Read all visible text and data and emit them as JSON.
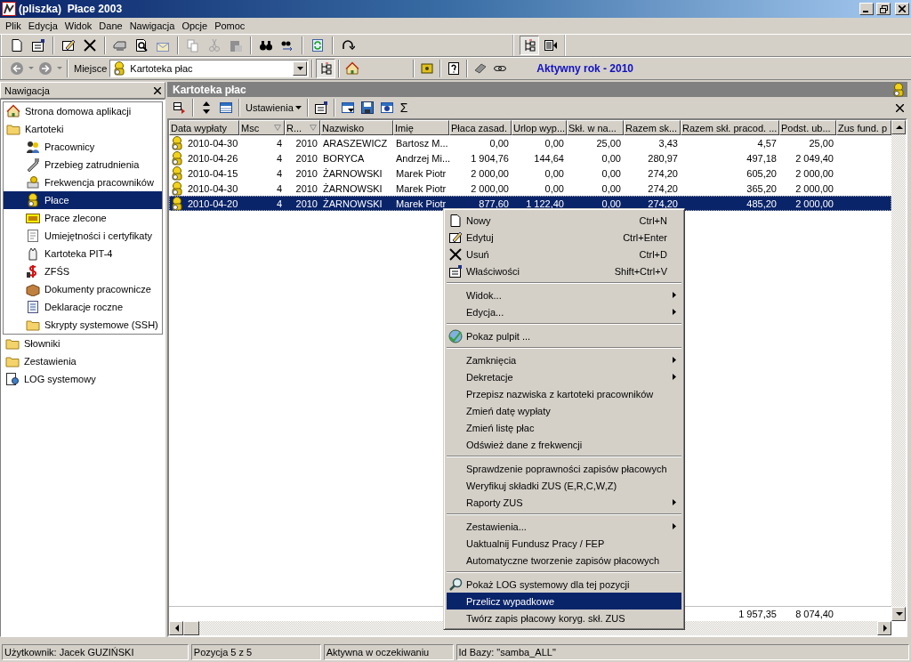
{
  "window": {
    "title": "(pliszka)  Płace 2003"
  },
  "menu": [
    "Plik",
    "Edycja",
    "Widok",
    "Dane",
    "Nawigacja",
    "Opcje",
    "Pomoc"
  ],
  "location": {
    "label": "Miejsce",
    "value": "Kartoteka płac"
  },
  "active_year": "Aktywny rok - 2010",
  "navigation": {
    "title": "Nawigacja",
    "items": [
      {
        "label": "Strona domowa aplikacji",
        "selected": false
      },
      {
        "label": "Kartoteki",
        "selected": false,
        "children": [
          {
            "label": "Pracownicy",
            "selected": false
          },
          {
            "label": "Przebieg zatrudnienia",
            "selected": false
          },
          {
            "label": "Frekwencja pracowników",
            "selected": false
          },
          {
            "label": "Płace",
            "selected": true
          },
          {
            "label": "Prace zlecone",
            "selected": false
          },
          {
            "label": "Umiejętności i certyfikaty",
            "selected": false
          },
          {
            "label": "Kartoteka PIT-4",
            "selected": false
          },
          {
            "label": "ZFŚS",
            "selected": false
          },
          {
            "label": "Dokumenty pracownicze",
            "selected": false
          },
          {
            "label": "Deklaracje roczne",
            "selected": false
          },
          {
            "label": "Skrypty systemowe (SSH)",
            "selected": false
          }
        ]
      },
      {
        "label": "Słowniki",
        "selected": false
      },
      {
        "label": "Zestawienia",
        "selected": false
      },
      {
        "label": "LOG systemowy",
        "selected": false
      }
    ]
  },
  "pane": {
    "title": "Kartoteka płac",
    "settings_button": "Ustawienia",
    "sum_button": "Σ"
  },
  "table": {
    "columns": [
      {
        "label": "Data wypłaty",
        "kind": "text",
        "filtered": false
      },
      {
        "label": "Msc",
        "kind": "number",
        "filtered": true
      },
      {
        "label": "R...",
        "kind": "number",
        "filtered": true
      },
      {
        "label": "Nazwisko",
        "kind": "text",
        "filtered": false
      },
      {
        "label": "Imię",
        "kind": "text",
        "filtered": false
      },
      {
        "label": "Płaca zasad.",
        "kind": "number",
        "filtered": false
      },
      {
        "label": "Urlop wyp...",
        "kind": "number",
        "filtered": false
      },
      {
        "label": "Skł. w na...",
        "kind": "number",
        "filtered": false
      },
      {
        "label": "Razem sk...",
        "kind": "number",
        "filtered": false
      },
      {
        "label": "Razem skł. pracod. ...",
        "kind": "number",
        "filtered": false,
        "total": "1 957,35"
      },
      {
        "label": "Podst. ub...",
        "kind": "number",
        "filtered": false,
        "total": "8 074,40"
      },
      {
        "label": "Zus fund. p",
        "kind": "number",
        "filtered": false
      }
    ],
    "rows": [
      {
        "selected": false,
        "cells": [
          "2010-04-30",
          "4",
          "2010",
          "ARASZEWICZ",
          "Bartosz M...",
          "0,00",
          "0,00",
          "25,00",
          "3,43",
          "4,57",
          "25,00"
        ]
      },
      {
        "selected": false,
        "cells": [
          "2010-04-26",
          "4",
          "2010",
          "BORYCA",
          "Andrzej Mi...",
          "1 904,76",
          "144,64",
          "0,00",
          "280,97",
          "497,18",
          "2 049,40"
        ]
      },
      {
        "selected": false,
        "cells": [
          "2010-04-15",
          "4",
          "2010",
          "ŻARNOWSKI",
          "Marek Piotr",
          "2 000,00",
          "0,00",
          "0,00",
          "274,20",
          "605,20",
          "2 000,00"
        ]
      },
      {
        "selected": false,
        "cells": [
          "2010-04-30",
          "4",
          "2010",
          "ŻARNOWSKI",
          "Marek Piotr",
          "2 000,00",
          "0,00",
          "0,00",
          "274,20",
          "365,20",
          "2 000,00"
        ]
      },
      {
        "selected": true,
        "cells": [
          "2010-04-20",
          "4",
          "2010",
          "ŻARNOWSKI",
          "Marek Piotr",
          "877,60",
          "1 122,40",
          "0,00",
          "274,20",
          "485,20",
          "2 000,00"
        ]
      }
    ]
  },
  "context_menu": [
    {
      "kind": "item",
      "label": "Nowy",
      "shortcut": "Ctrl+N",
      "submenu": false,
      "selected": false
    },
    {
      "kind": "item",
      "label": "Edytuj",
      "shortcut": "Ctrl+Enter",
      "submenu": false,
      "selected": false
    },
    {
      "kind": "item",
      "label": "Usuń",
      "shortcut": "Ctrl+D",
      "submenu": false,
      "selected": false
    },
    {
      "kind": "item",
      "label": "Właściwości",
      "shortcut": "Shift+Ctrl+V",
      "submenu": false,
      "selected": false
    },
    {
      "kind": "separator"
    },
    {
      "kind": "item",
      "label": "Widok...",
      "submenu": true,
      "selected": false
    },
    {
      "kind": "item",
      "label": "Edycja...",
      "submenu": true,
      "selected": false
    },
    {
      "kind": "separator"
    },
    {
      "kind": "item",
      "label": "Pokaz pulpit ...",
      "submenu": false,
      "selected": false
    },
    {
      "kind": "separator"
    },
    {
      "kind": "item",
      "label": "Zamknięcia",
      "submenu": true,
      "selected": false
    },
    {
      "kind": "item",
      "label": "Dekretacje",
      "submenu": true,
      "selected": false
    },
    {
      "kind": "item",
      "label": "Przepisz nazwiska z kartoteki pracowników",
      "submenu": false,
      "selected": false
    },
    {
      "kind": "item",
      "label": "Zmień datę wypłaty",
      "submenu": false,
      "selected": false
    },
    {
      "kind": "item",
      "label": "Zmień listę płac",
      "submenu": false,
      "selected": false
    },
    {
      "kind": "item",
      "label": "Odśwież dane z frekwencji",
      "submenu": false,
      "selected": false
    },
    {
      "kind": "separator"
    },
    {
      "kind": "item",
      "label": "Sprawdzenie poprawności zapisów płacowych",
      "submenu": false,
      "selected": false
    },
    {
      "kind": "item",
      "label": "Weryfikuj składki ZUS (E,R,C,W,Z)",
      "submenu": false,
      "selected": false
    },
    {
      "kind": "item",
      "label": "Raporty ZUS",
      "submenu": true,
      "selected": false
    },
    {
      "kind": "separator"
    },
    {
      "kind": "item",
      "label": "Zestawienia...",
      "submenu": true,
      "selected": false
    },
    {
      "kind": "item",
      "label": "Uaktualnij Fundusz Pracy / FEP",
      "submenu": false,
      "selected": false
    },
    {
      "kind": "item",
      "label": "Automatyczne tworzenie zapisów płacowych",
      "submenu": false,
      "selected": false
    },
    {
      "kind": "separator"
    },
    {
      "kind": "item",
      "label": "Pokaż LOG systemowy dla tej pozycji",
      "submenu": false,
      "selected": false
    },
    {
      "kind": "item",
      "label": "Przelicz wypadkowe",
      "submenu": false,
      "selected": true
    },
    {
      "kind": "item",
      "label": "Twórz zapis płacowy koryg. skł. ZUS",
      "submenu": false,
      "selected": false
    }
  ],
  "status_bar": [
    "Użytkownik: Jacek GUZIŃSKI",
    "Pozycja 5 z 5",
    "Aktywna w oczekiwaniu",
    "Id Bazy: \"samba_ALL\""
  ]
}
